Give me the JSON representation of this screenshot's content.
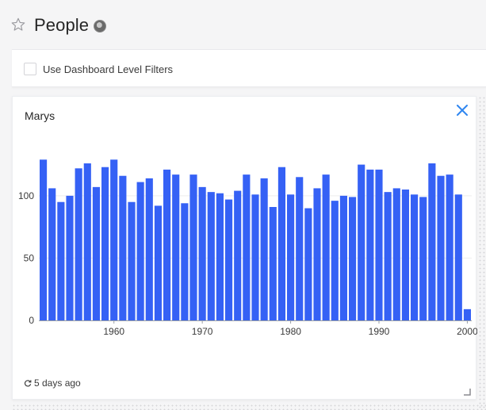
{
  "header": {
    "title": "People",
    "star_icon": "star-outline-icon",
    "avatar": "avatar"
  },
  "filters": {
    "use_dashboard_filters_label": "Use Dashboard Level Filters",
    "checked": false
  },
  "card": {
    "title": "Marys",
    "close_icon": "close-icon",
    "refresh_icon": "refresh-icon",
    "refreshed_label": "5 days ago",
    "accent_color": "#2f87f0",
    "bar_color": "#3561f5"
  },
  "chart_data": {
    "type": "bar",
    "x": [
      1952,
      1953,
      1954,
      1955,
      1956,
      1957,
      1958,
      1959,
      1960,
      1961,
      1962,
      1963,
      1964,
      1965,
      1966,
      1967,
      1968,
      1969,
      1970,
      1971,
      1972,
      1973,
      1974,
      1975,
      1976,
      1977,
      1978,
      1979,
      1980,
      1981,
      1982,
      1983,
      1984,
      1985,
      1986,
      1987,
      1988,
      1989,
      1990,
      1991,
      1992,
      1993,
      1994,
      1995,
      1996,
      1997,
      1998,
      1999,
      2000
    ],
    "values": [
      129,
      106,
      95,
      100,
      122,
      126,
      107,
      123,
      129,
      116,
      95,
      111,
      114,
      92,
      121,
      117,
      94,
      117,
      107,
      103,
      102,
      97,
      104,
      117,
      101,
      114,
      91,
      123,
      101,
      115,
      90,
      106,
      117,
      96,
      100,
      99,
      125,
      121,
      121,
      103,
      106,
      105,
      101,
      99,
      126,
      116,
      117,
      101,
      9
    ],
    "xlim": [
      1951.5,
      2000.5
    ],
    "ylim": [
      0,
      140
    ],
    "xticks": [
      1960,
      1970,
      1980,
      1990,
      2000
    ],
    "yticks": [
      0,
      50,
      100
    ],
    "grid": true,
    "title": "",
    "xlabel": "",
    "ylabel": ""
  }
}
